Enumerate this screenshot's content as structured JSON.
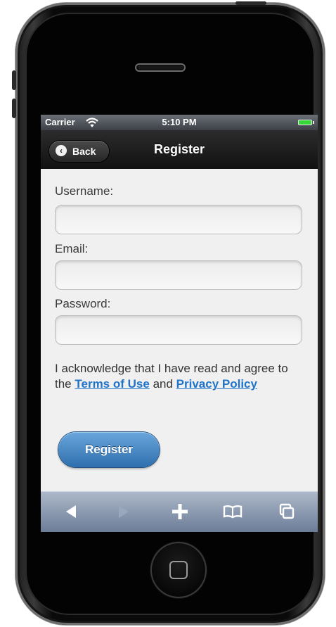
{
  "status_bar": {
    "carrier": "Carrier",
    "time": "5:10 PM",
    "wifi_icon": "wifi-icon",
    "battery_icon": "battery-icon",
    "battery_color": "#36d63a"
  },
  "nav_bar": {
    "back_label": "Back",
    "title": "Register"
  },
  "form": {
    "username_label": "Username:",
    "username_value": "",
    "email_label": "Email:",
    "email_value": "",
    "password_label": "Password:",
    "password_value": "",
    "ack_prefix": "I acknowledge that I have read and agree to the",
    "terms_link": "Terms of Use",
    "ack_and": "and",
    "privacy_link": "Privacy Policy",
    "register_label": "Register"
  },
  "toolbar": {
    "items": [
      "back-arrow-icon",
      "forward-arrow-icon",
      "add-icon",
      "bookmarks-icon",
      "pages-icon"
    ]
  },
  "colors": {
    "link": "#1f73c9",
    "button": "#3d7fc0",
    "nav_bar": "#1a1a1a",
    "toolbar": "#8d9bb2"
  }
}
